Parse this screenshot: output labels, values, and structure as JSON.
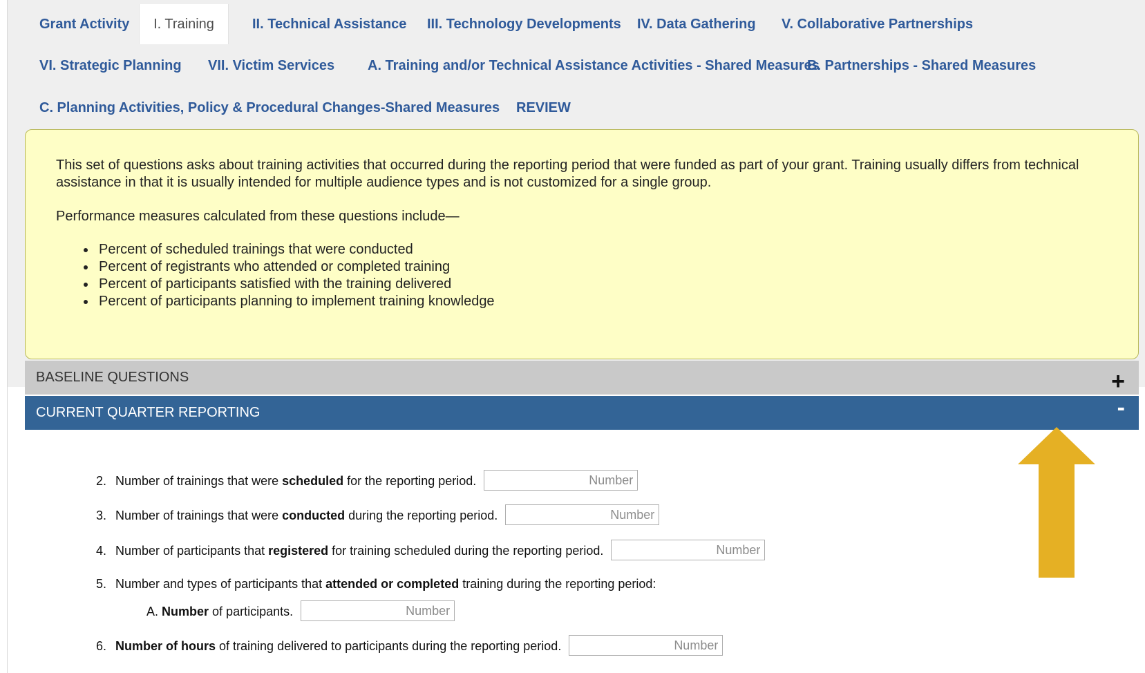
{
  "tabs": [
    {
      "label": "Grant Activity"
    },
    {
      "label": "I. Training",
      "active": true
    },
    {
      "label": "II. Technical Assistance"
    },
    {
      "label": "III. Technology Developments"
    },
    {
      "label": "IV. Data Gathering"
    },
    {
      "label": "V. Collaborative Partnerships"
    },
    {
      "label": "VI. Strategic Planning"
    },
    {
      "label": "VII. Victim Services"
    },
    {
      "label": "A. Training and/or Technical Assistance Activities - Shared Measures"
    },
    {
      "label": "B. Partnerships - Shared Measures"
    },
    {
      "label": "C. Planning Activities, Policy & Procedural Changes-Shared Measures"
    },
    {
      "label": "REVIEW"
    }
  ],
  "intro": {
    "paragraph": "This set of questions asks about training activities that occurred during the reporting period that were funded as part of your grant. Training usually differs from technical assistance in that it is usually intended for multiple audience types and is not customized for a single group.",
    "measures_title": "Performance measures calculated from these questions include—",
    "bullets": [
      "Percent of scheduled trainings that were conducted",
      "Percent of registrants who attended or completed training",
      "Percent of participants satisfied with the training delivered",
      "Percent of participants planning to implement training knowledge"
    ]
  },
  "sections": {
    "baseline": {
      "label": "BASELINE QUESTIONS",
      "toggle": "+"
    },
    "current": {
      "label": "CURRENT QUARTER REPORTING",
      "toggle": "-"
    }
  },
  "questions": {
    "q2": {
      "num": "2.",
      "pre": "Number of trainings that were ",
      "bold": "scheduled",
      "post": " for the reporting period.",
      "placeholder": "Number"
    },
    "q3": {
      "num": "3.",
      "pre": "Number of trainings that were ",
      "bold": "conducted",
      "post": " during the reporting period.",
      "placeholder": "Number"
    },
    "q4": {
      "num": "4.",
      "pre": "Number of participants that ",
      "bold": "registered",
      "post": " for training scheduled during the reporting period.",
      "placeholder": "Number"
    },
    "q5": {
      "num": "5.",
      "pre": "Number and types of participants that ",
      "bold": "attended or completed",
      "post": " training during the reporting period:"
    },
    "q5a": {
      "num": "A.",
      "bold": "Number",
      "post": " of participants.",
      "placeholder": "Number"
    },
    "q6": {
      "num": "6.",
      "bold": "Number of hours",
      "post": " of training delivered to participants during the reporting period.",
      "placeholder": "Number"
    }
  },
  "colors": {
    "tab_link": "#2f5a9a",
    "intro_background": "#fefec6",
    "section_expanded": "#336496",
    "section_collapsed": "#c9c9c9",
    "arrow": "#e5b024"
  }
}
